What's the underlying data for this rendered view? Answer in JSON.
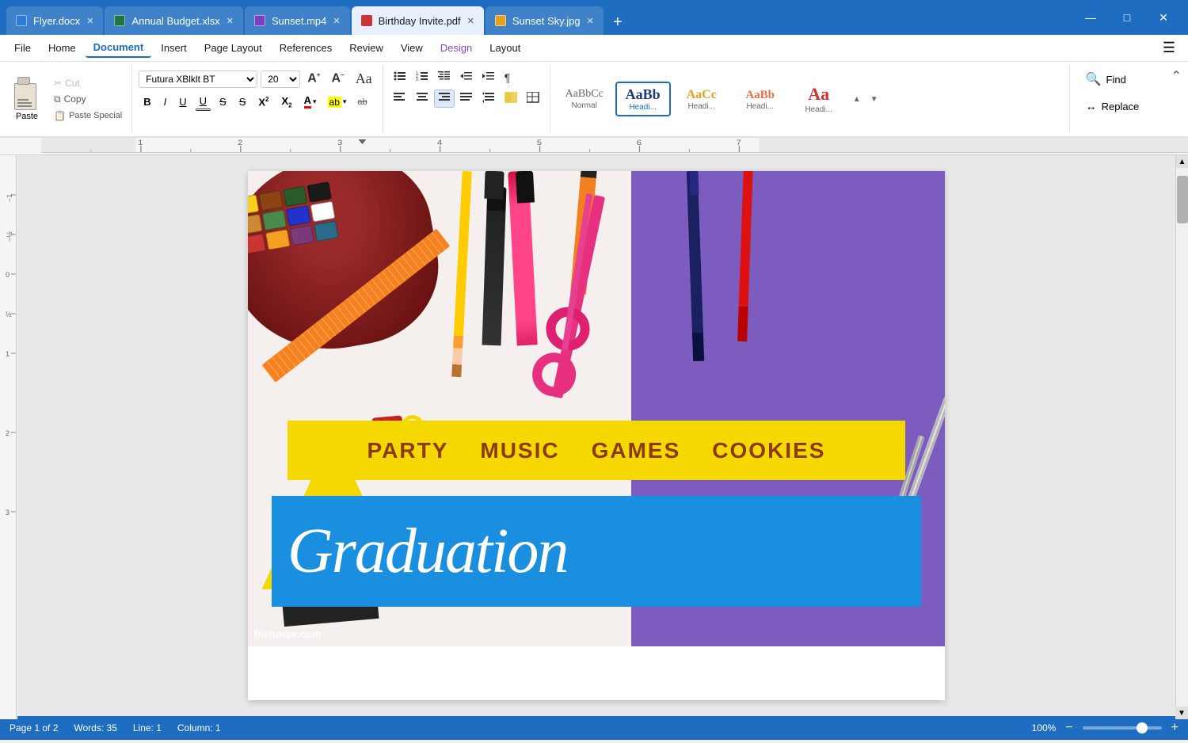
{
  "titleBar": {
    "tabs": [
      {
        "id": "flyer",
        "name": "Flyer.docx",
        "type": "docx",
        "active": false,
        "color": "#2c7bd6"
      },
      {
        "id": "budget",
        "name": "Annual Budget.xlsx",
        "type": "xlsx",
        "active": false,
        "color": "#217346"
      },
      {
        "id": "sunset",
        "name": "Sunset.mp4",
        "type": "mp4",
        "active": false,
        "color": "#7b3fbe"
      },
      {
        "id": "birthday",
        "name": "Birthday Invite.pdf",
        "type": "pdf",
        "active": true,
        "color": "#cc3333"
      },
      {
        "id": "sky",
        "name": "Sunset Sky.jpg",
        "type": "jpg",
        "active": false,
        "color": "#e8a020"
      }
    ],
    "newTabLabel": "+",
    "minimizeIcon": "—",
    "maximizeIcon": "□",
    "closeIcon": "✕"
  },
  "menuBar": {
    "items": [
      {
        "id": "file",
        "label": "File",
        "active": false
      },
      {
        "id": "home",
        "label": "Home",
        "active": false
      },
      {
        "id": "document",
        "label": "Document",
        "active": true
      },
      {
        "id": "insert",
        "label": "Insert",
        "active": false
      },
      {
        "id": "pagelayout",
        "label": "Page Layout",
        "active": false
      },
      {
        "id": "references",
        "label": "References",
        "active": false
      },
      {
        "id": "review",
        "label": "Review",
        "active": false
      },
      {
        "id": "view",
        "label": "View",
        "active": false
      },
      {
        "id": "design",
        "label": "Design",
        "active": false,
        "special": "design"
      },
      {
        "id": "layout",
        "label": "Layout",
        "active": false
      }
    ]
  },
  "ribbon": {
    "pasteGroup": {
      "pasteLabel": "Paste",
      "cutLabel": "Cut",
      "copyLabel": "Copy",
      "pasteSpecialLabel": "Paste Special"
    },
    "fontGroup": {
      "fontName": "Futura XBlklt BT",
      "fontSize": "20",
      "growLabel": "A",
      "shrinkLabel": "A",
      "fontColorLabel": "A",
      "highlightLabel": "ab",
      "clearFormatLabel": "ab",
      "boldLabel": "B",
      "italicLabel": "I",
      "underline1Label": "U",
      "underline2Label": "U",
      "strikethrough1Label": "S",
      "strikethrough2Label": "S",
      "superscriptLabel": "X",
      "subscriptLabel": "X",
      "aaLabel": "Aa"
    },
    "paragraphGroup": {
      "bulletLabel": "≡",
      "numberedLabel": "≡",
      "outlineLabel": "≡",
      "decreaseLabel": "←",
      "increaseLabel": "→",
      "pilcrowLabel": "¶",
      "alignLeftLabel": "≡",
      "alignCenterLabel": "≡",
      "alignRightLabel": "≡",
      "alignJustifyLabel": "≡",
      "lineSpacingLabel": "↕",
      "shadingLabel": "▓"
    },
    "stylesGroup": {
      "styles": [
        {
          "id": "normal",
          "preview": "AaBbCc",
          "label": "Normal",
          "selected": false,
          "class": "style-normal"
        },
        {
          "id": "heading1",
          "preview": "AaBb",
          "label": "Headi...",
          "selected": true,
          "class": "style-heading1"
        },
        {
          "id": "heading2",
          "preview": "AaCc",
          "label": "Headi...",
          "selected": false,
          "class": "style-heading2"
        },
        {
          "id": "heading3",
          "preview": "AaBb",
          "label": "Headi...",
          "selected": false,
          "class": "style-heading3"
        },
        {
          "id": "heading4",
          "preview": "Aa",
          "label": "Headi...",
          "selected": false,
          "class": "style-heading4"
        }
      ]
    },
    "findGroup": {
      "findLabel": "Find",
      "replaceLabel": "Replace"
    }
  },
  "document": {
    "yellowBanner": {
      "items": [
        "PARTY",
        "MUSIC",
        "GAMES",
        "COOKIES"
      ]
    },
    "blueBanner": {
      "text": "Graduation"
    },
    "watermark": "filehorse.com"
  },
  "statusBar": {
    "pageInfo": "Page 1 of 2",
    "wordCount": "Words: 35",
    "lineInfo": "Line: 1",
    "columnInfo": "Column: 1",
    "zoomLevel": "100%",
    "zoomMinus": "−",
    "zoomPlus": "+"
  }
}
